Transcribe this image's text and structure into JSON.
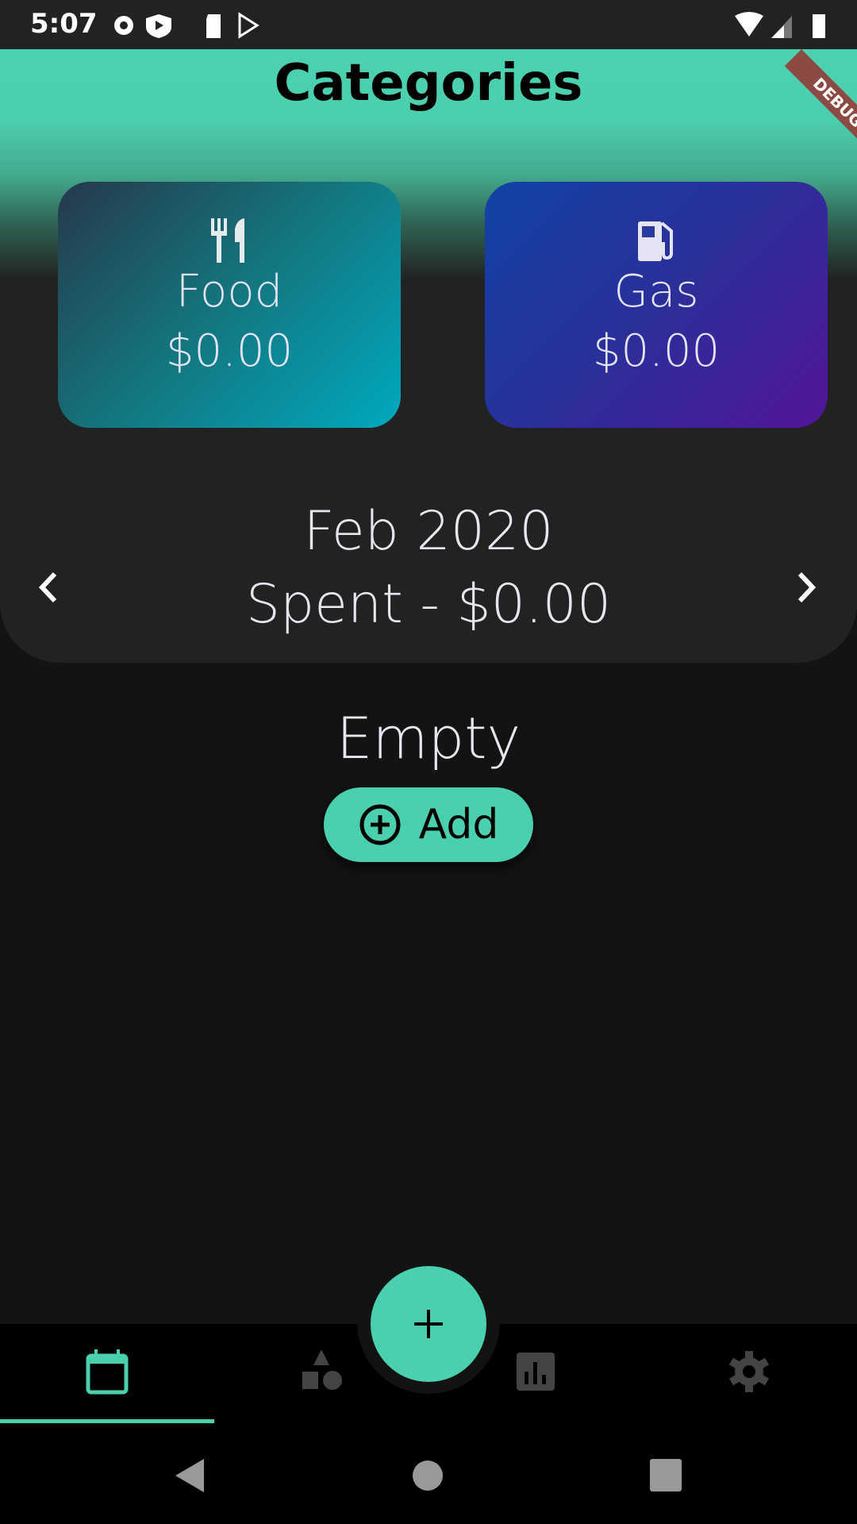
{
  "status_bar": {
    "time": "5:07"
  },
  "header": {
    "title": "Categories",
    "debug_banner": "DEBUG"
  },
  "categories": [
    {
      "name": "Food",
      "amount": "$0.00",
      "icon": "restaurant-icon"
    },
    {
      "name": "Gas",
      "amount": "$0.00",
      "icon": "gas-station-icon"
    }
  ],
  "period": {
    "month": "Feb 2020",
    "spent": "Spent - $0.00"
  },
  "empty_state": {
    "text": "Empty",
    "add_label": "Add"
  },
  "bottom_nav": {
    "items": [
      "calendar-icon",
      "shapes-icon",
      "chart-icon",
      "settings-icon"
    ],
    "active": 0
  },
  "colors": {
    "accent": "#4bd0af"
  }
}
